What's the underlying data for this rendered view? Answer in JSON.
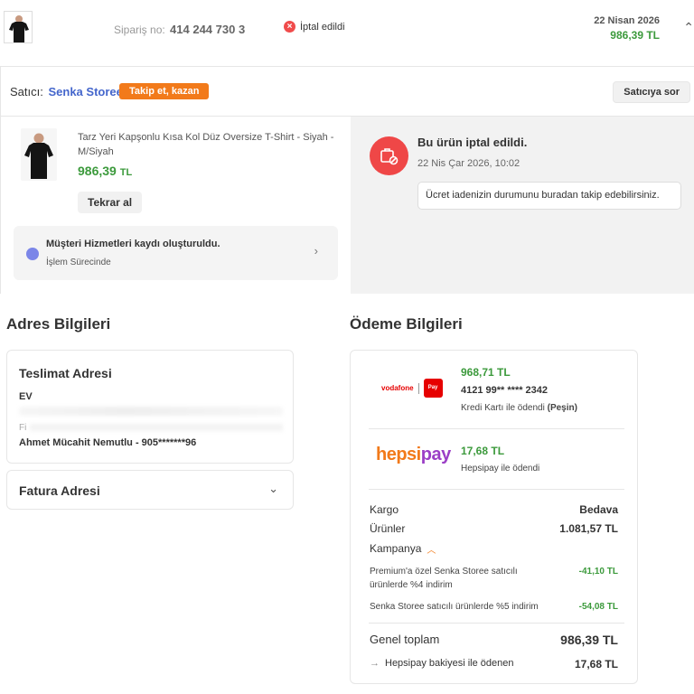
{
  "header": {
    "order_label": "Sipariş no:",
    "order_number": "414 244 730 3",
    "status_text": "İptal edildi",
    "date": "22 Nisan 2026",
    "total": "986,39 TL"
  },
  "seller": {
    "label": "Satıcı:",
    "name": "Senka Storee",
    "follow_label": "Takip et, kazan",
    "ask_label": "Satıcıya sor"
  },
  "product": {
    "name": "Tarz Yeri Kapşonlu Kısa Kol Düz Oversize T-Shirt - Siyah - M/Siyah",
    "price": "986,39",
    "currency": "TL",
    "reorder_label": "Tekrar al"
  },
  "customer_service": {
    "title": "Müşteri Hizmetleri kaydı oluşturuldu.",
    "status": "İşlem Sürecinde"
  },
  "cancellation": {
    "title": "Bu ürün iptal edildi.",
    "date": "22 Nis Çar 2026, 10:02",
    "refund_link": "Ücret iadenizin durumunu buradan takip edebilirsiniz."
  },
  "address": {
    "section_title": "Adres Bilgileri",
    "delivery_title": "Teslimat Adresi",
    "type": "EV",
    "blur_prefix": "Fi",
    "person": "Ahmet Mücahit Nemutlu - 905*******96",
    "invoice_title": "Fatura Adresi"
  },
  "payment": {
    "section_title": "Ödeme Bilgileri",
    "vodafone": {
      "brand": "vodafone",
      "pay": "Pay",
      "amount": "968,71 TL",
      "card": "4121 99** **** 2342",
      "desc": "Kredi Kartı ile ödendi",
      "desc_bold": "(Peşin)"
    },
    "hepsipay": {
      "logo_a": "hepsi",
      "logo_b": "pay",
      "amount": "17,68 TL",
      "desc": "Hepsipay ile ödendi"
    },
    "summary": {
      "shipping_label": "Kargo",
      "shipping_value": "Bedava",
      "products_label": "Ürünler",
      "products_value": "1.081,57 TL",
      "campaign_label": "Kampanya",
      "discount1_label": "Premium'a özel Senka Storee satıcılı ürünlerde %4 indirim",
      "discount1_value": "-41,10 TL",
      "discount2_label": "Senka Storee satıcılı ürünlerde %5 indirim",
      "discount2_value": "-54,08 TL",
      "total_label": "Genel toplam",
      "total_value": "986,39 TL",
      "hepsipay_balance_label": "Hepsipay bakiyesi ile ödenen",
      "hepsipay_balance_value": "17,68 TL"
    }
  },
  "colors": {
    "accent_orange": "#f27a1a",
    "price_green": "#3c9a3c",
    "cancel_red": "#ef4747",
    "seller_blue": "#4466cc"
  }
}
